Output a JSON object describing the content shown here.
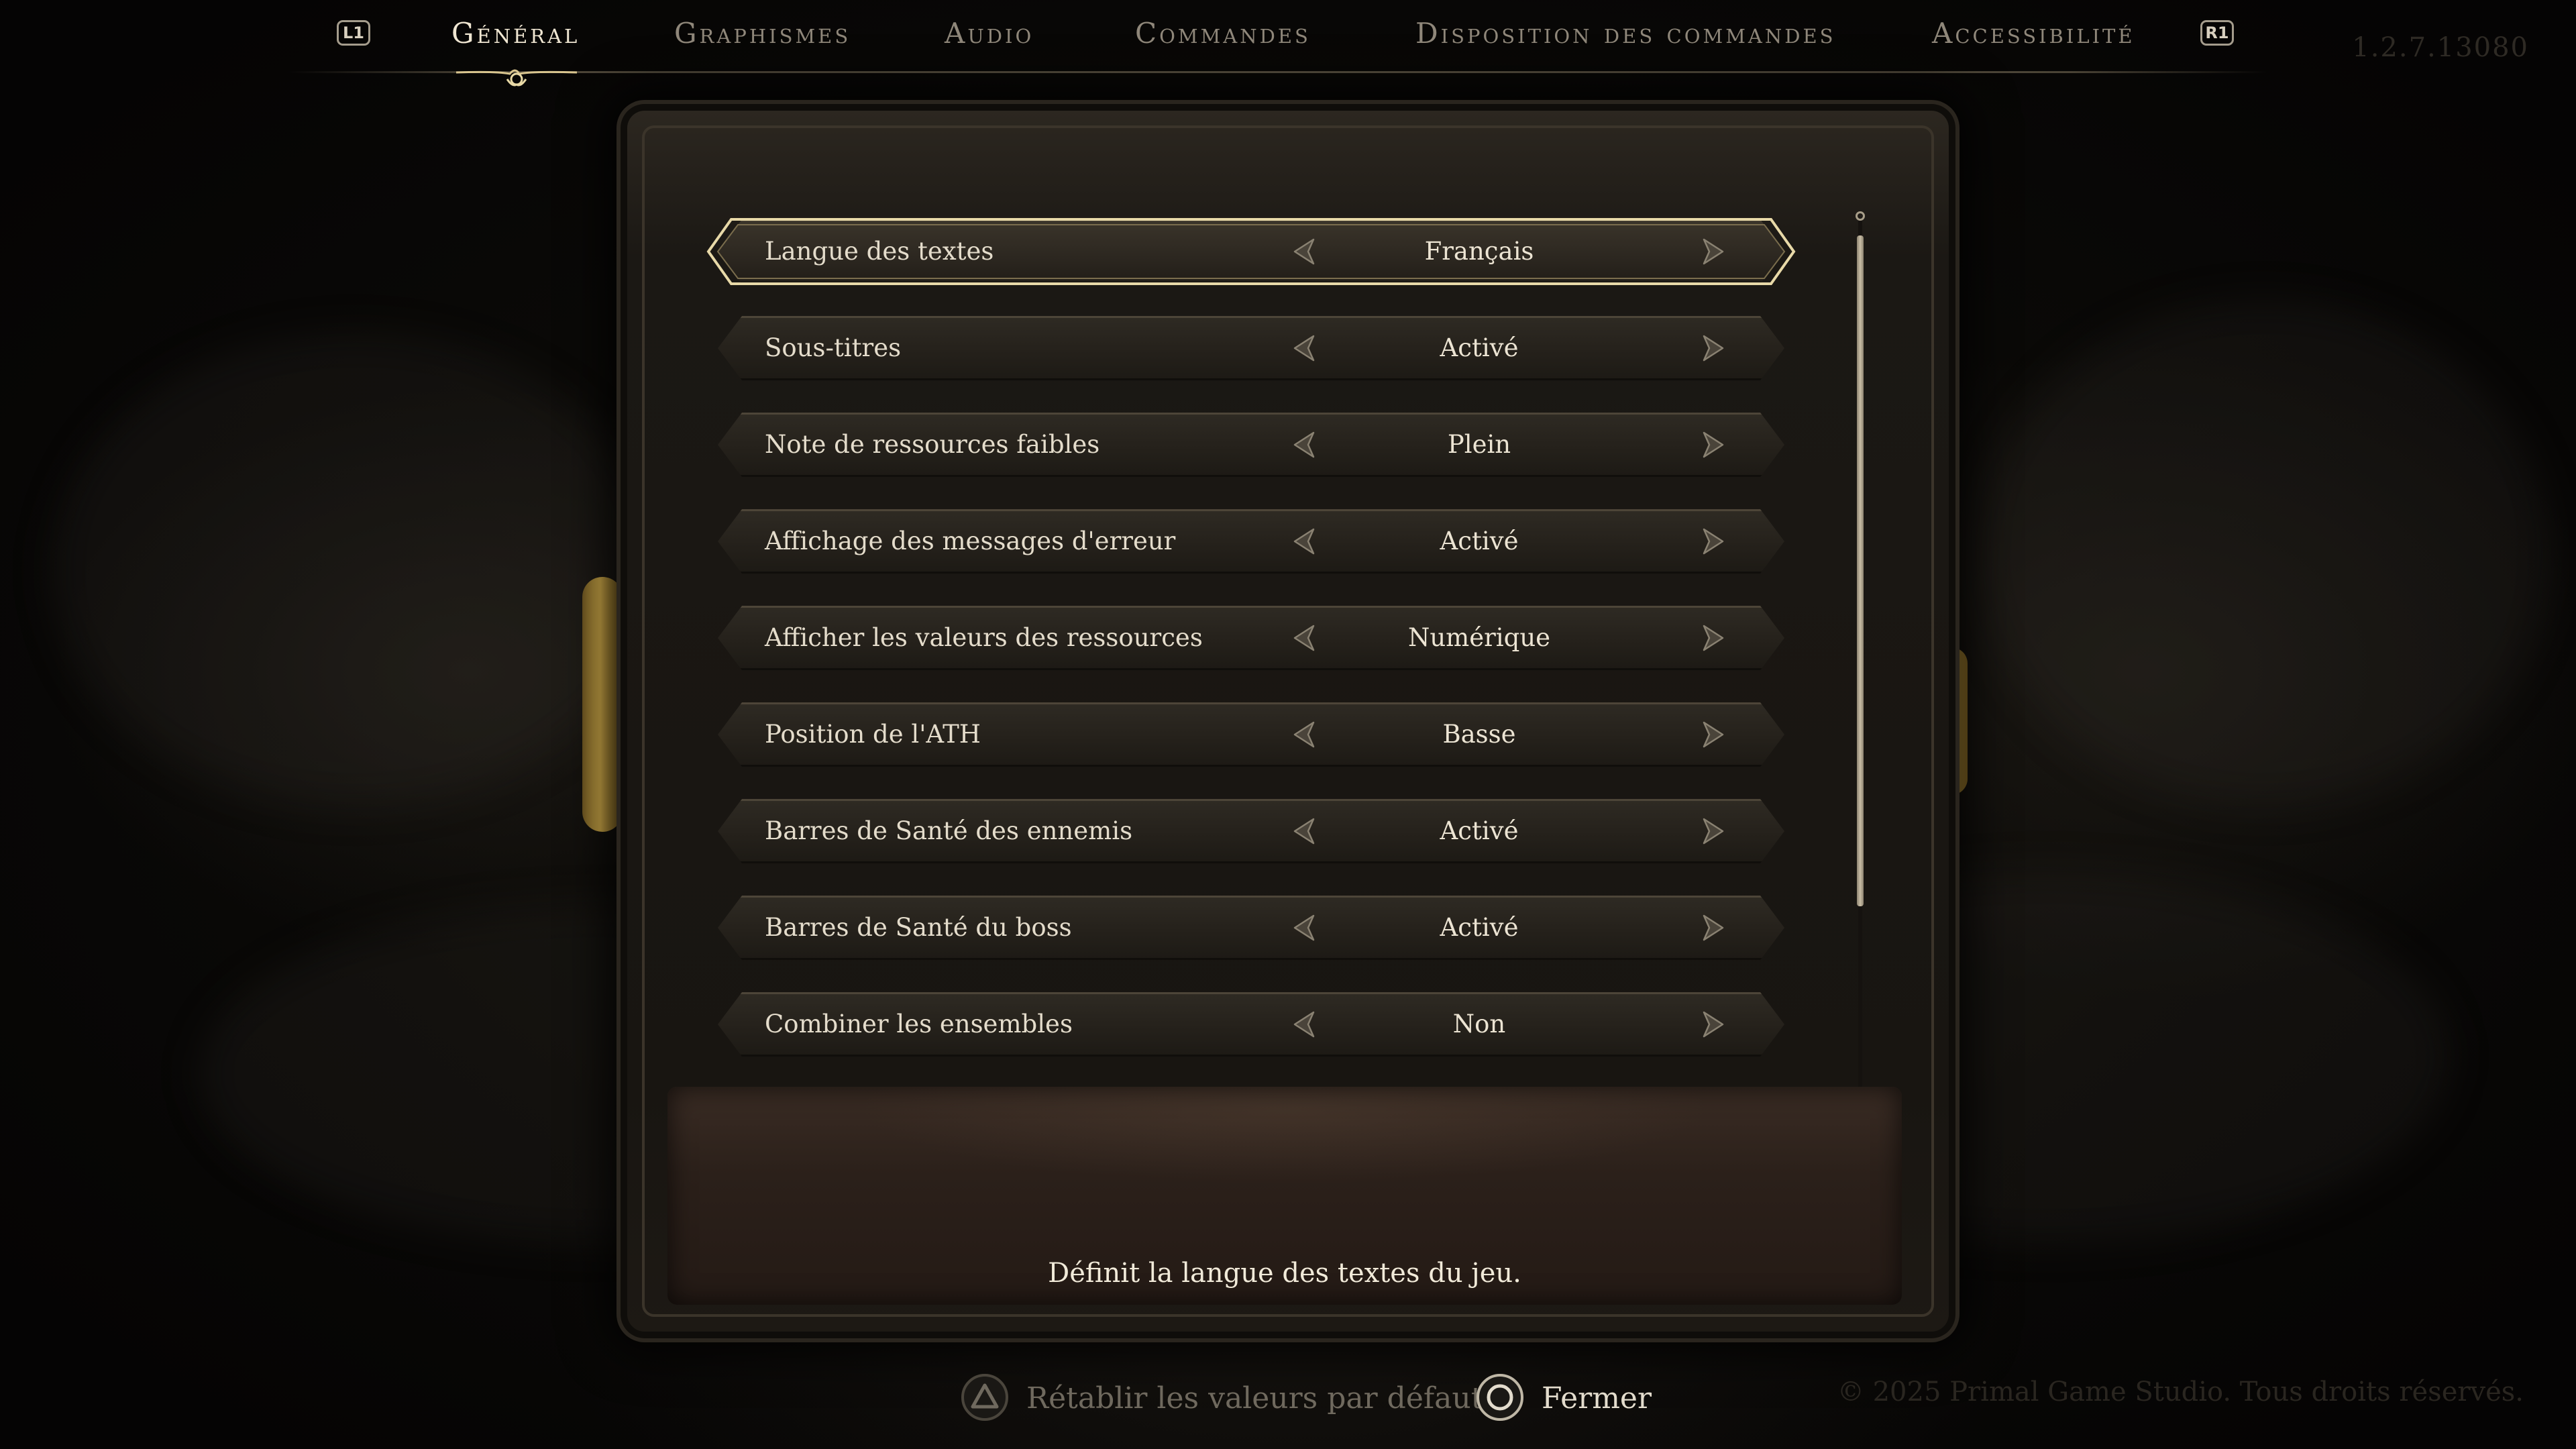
{
  "version": "1.2.7.13080",
  "nav": {
    "left_bumper": "L1",
    "right_bumper": "R1",
    "tabs": [
      {
        "label": "Général",
        "active": true
      },
      {
        "label": "Graphismes",
        "active": false
      },
      {
        "label": "Audio",
        "active": false
      },
      {
        "label": "Commandes",
        "active": false
      },
      {
        "label": "Disposition des commandes",
        "active": false
      },
      {
        "label": "Accessibilité",
        "active": false
      }
    ]
  },
  "settings": [
    {
      "label": "Langue des textes",
      "value": "Français",
      "selected": true
    },
    {
      "label": "Sous-titres",
      "value": "Activé",
      "selected": false
    },
    {
      "label": "Note de ressources faibles",
      "value": "Plein",
      "selected": false
    },
    {
      "label": "Affichage des messages d'erreur",
      "value": "Activé",
      "selected": false
    },
    {
      "label": "Afficher les valeurs des ressources",
      "value": "Numérique",
      "selected": false
    },
    {
      "label": "Position de l'ATH",
      "value": "Basse",
      "selected": false
    },
    {
      "label": "Barres de Santé des ennemis",
      "value": "Activé",
      "selected": false
    },
    {
      "label": "Barres de Santé du boss",
      "value": "Activé",
      "selected": false
    },
    {
      "label": "Combiner les ensembles",
      "value": "Non",
      "selected": false
    }
  ],
  "description": "Définit la langue des textes du jeu.",
  "footer": {
    "reset": {
      "icon": "triangle-button-icon",
      "label": "Rétablir les valeurs par défaut"
    },
    "close": {
      "icon": "circle-button-icon",
      "label": "Fermer"
    },
    "copyright": "© 2025 Primal Game Studio. Tous droits réservés."
  },
  "colors": {
    "accent_gold": "#d9b24c",
    "text_primary": "#e4dccb",
    "text_inactive": "#8f877a",
    "background": "#070605"
  }
}
